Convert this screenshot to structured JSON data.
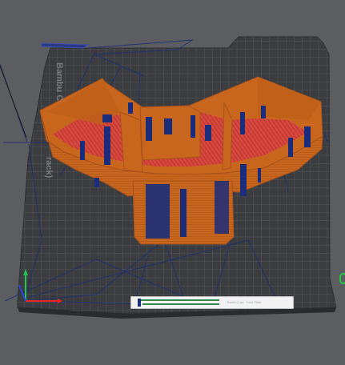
{
  "scene": {
    "plate_brand": "Bambu C",
    "plate_sublabel": "rack)",
    "plate_tag_text": "Bambu Lab · Cool Plate",
    "background_color": "#5c5d61",
    "plate_color": "#3b3c40",
    "grid_color": "#55565b",
    "model_color": "#c8661e",
    "model_dark": "#a9521a",
    "support_color": "#1b2d7a",
    "infill_color": "#d8463e",
    "travel_color": "#1d2f70",
    "axis_x_color": "#e8232b",
    "axis_y_color": "#22c34a",
    "axis_z_color": "#2c44d8",
    "handle_color": "#27c93f"
  },
  "icons": {
    "axis_gizmo": "xyz-axis-icon",
    "handle": "view-handle-icon"
  }
}
